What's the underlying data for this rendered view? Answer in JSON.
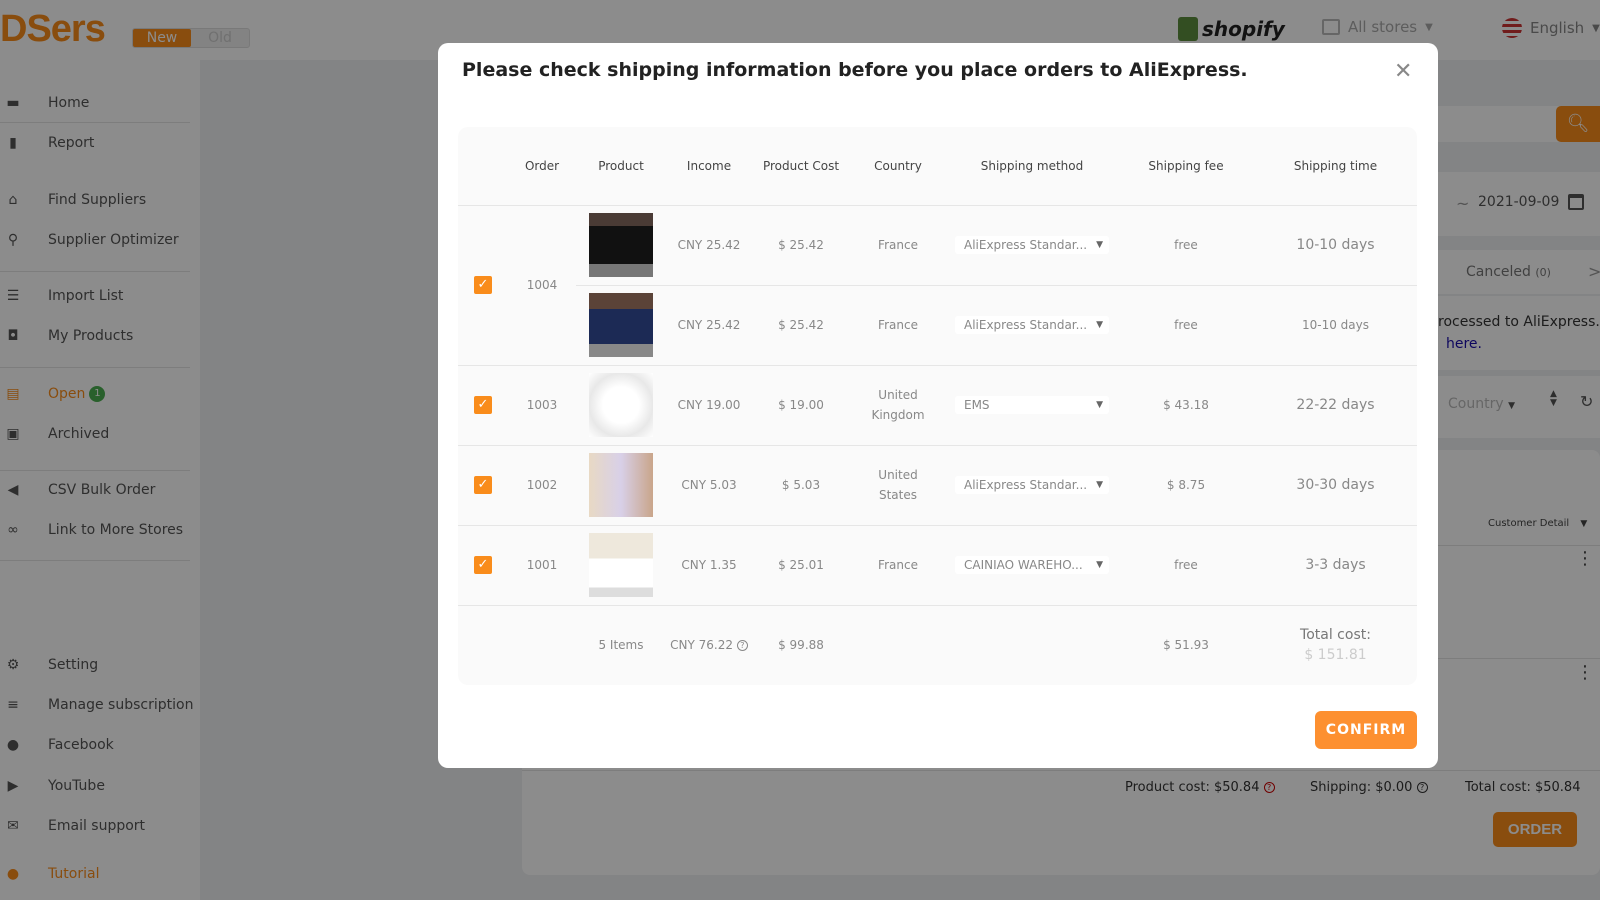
{
  "header": {
    "logo": "DSers",
    "version_new": "New",
    "version_old": "Old",
    "platform": "shopify",
    "store_select": "All stores",
    "language": "English"
  },
  "sidebar": {
    "items": [
      {
        "label": "Home",
        "icon": "store-icon"
      },
      {
        "label": "Report",
        "icon": "chart-icon"
      },
      {
        "label": "Find Suppliers",
        "icon": "house-icon"
      },
      {
        "label": "Supplier Optimizer",
        "icon": "search-icon"
      },
      {
        "label": "Import List",
        "icon": "list-icon"
      },
      {
        "label": "My Products",
        "icon": "bag-icon"
      },
      {
        "label": "Open",
        "icon": "clipboard-icon",
        "badge": "1",
        "active": true
      },
      {
        "label": "Archived",
        "icon": "archive-icon"
      },
      {
        "label": "CSV Bulk Order",
        "icon": "megaphone-icon"
      },
      {
        "label": "Link to More Stores",
        "icon": "link-icon"
      },
      {
        "label": "Setting",
        "icon": "gear-icon"
      },
      {
        "label": "Manage subscription",
        "icon": "sliders-icon"
      },
      {
        "label": "Facebook",
        "icon": "facebook-icon"
      },
      {
        "label": "YouTube",
        "icon": "youtube-icon"
      },
      {
        "label": "Email support",
        "icon": "mail-icon"
      },
      {
        "label": "Tutorial",
        "icon": "bulb-icon",
        "active": true
      }
    ]
  },
  "background": {
    "date_to": "2021-09-09",
    "date_sep": "~",
    "tab_canceled": "Canceled",
    "tab_canceled_count": "(0)",
    "notice_text": "rocessed to AliExpress. I",
    "notice_link": "here.",
    "country_filter": "Country",
    "customer_detail": "Customer Detail",
    "product_cost": "Product cost: $50.84",
    "shipping": "Shipping: $0.00",
    "total_cost": "Total cost: $50.84",
    "order_button": "ORDER"
  },
  "modal": {
    "title": "Please check shipping information before you place orders to AliExpress.",
    "columns": [
      "Order",
      "Product",
      "Income",
      "Product Cost",
      "Country",
      "Shipping method",
      "Shipping fee",
      "Shipping time"
    ],
    "orders": [
      {
        "order": "1004",
        "checked": true,
        "items": [
          {
            "income": "CNY 25.42",
            "cost": "$ 25.42",
            "country": "France",
            "method": "AliExpress Standar...",
            "fee": "free",
            "time": "10-10 days",
            "thumb": "black pillows"
          },
          {
            "income": "CNY 25.42",
            "cost": "$ 25.42",
            "country": "France",
            "method": "AliExpress Standar...",
            "fee": "free",
            "time": "10-10 days",
            "thumb": "navy pillows"
          }
        ]
      },
      {
        "order": "1003",
        "checked": true,
        "items": [
          {
            "income": "CNY 19.00",
            "cost": "$ 19.00",
            "country": "United Kingdom",
            "method": "EMS",
            "fee": "$ 43.18",
            "time": "22-22 days",
            "thumb": "white pillows"
          }
        ]
      },
      {
        "order": "1002",
        "checked": true,
        "items": [
          {
            "income": "CNY 5.03",
            "cost": "$ 5.03",
            "country": "United States",
            "method": "AliExpress Standar...",
            "fee": "$ 8.75",
            "time": "30-30 days",
            "thumb": "pillow on bed"
          }
        ]
      },
      {
        "order": "1001",
        "checked": true,
        "items": [
          {
            "income": "CNY 1.35",
            "cost": "$ 25.01",
            "country": "France",
            "method": "CAINIAO WAREHO...",
            "fee": "free",
            "time": "3-3 days",
            "thumb": "bedroom pillows"
          }
        ]
      }
    ],
    "footer": {
      "items": "5 Items",
      "income": "CNY 76.22",
      "cost": "$ 99.88",
      "fee": "$ 51.93",
      "total_label": "Total cost:",
      "total_value": "$ 151.81"
    },
    "confirm": "CONFIRM"
  },
  "colors": {
    "accent": "#f98c1b",
    "confirm": "#fd9030",
    "badge": "#4caf50",
    "link": "#1a0dab"
  }
}
